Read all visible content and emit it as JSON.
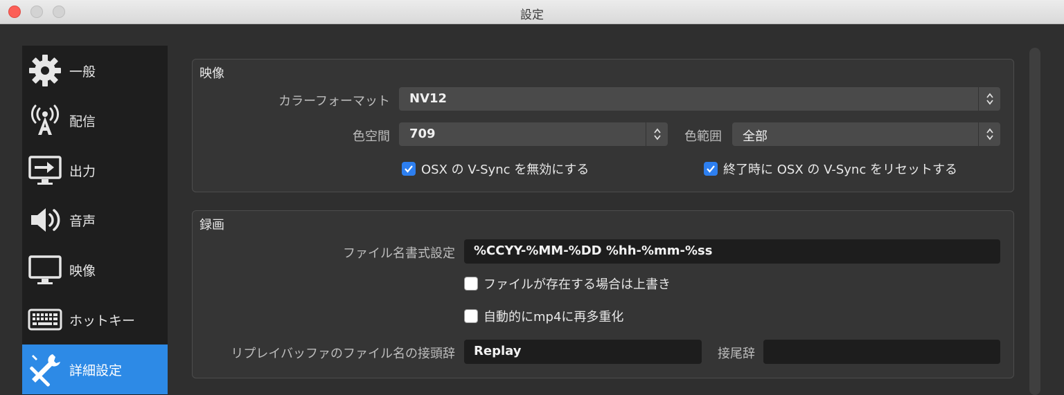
{
  "window": {
    "title": "設定"
  },
  "sidebar": {
    "items": [
      {
        "label": "一般",
        "icon": "gear-icon"
      },
      {
        "label": "配信",
        "icon": "broadcast-antenna-icon"
      },
      {
        "label": "出力",
        "icon": "output-monitor-icon"
      },
      {
        "label": "音声",
        "icon": "speaker-icon"
      },
      {
        "label": "映像",
        "icon": "monitor-icon"
      },
      {
        "label": "ホットキー",
        "icon": "keyboard-icon"
      },
      {
        "label": "詳細設定",
        "icon": "tools-icon",
        "active": true
      }
    ]
  },
  "video_group": {
    "title": "映像",
    "color_format_label": "カラーフォーマット",
    "color_format_value": "NV12",
    "color_space_label": "色空間",
    "color_space_value": "709",
    "color_range_label": "色範囲",
    "color_range_value": "全部",
    "disable_vsync_label": "OSX の V-Sync を無効にする",
    "disable_vsync_checked": true,
    "reset_vsync_label": "終了時に OSX の V-Sync をリセットする",
    "reset_vsync_checked": true
  },
  "recording_group": {
    "title": "録画",
    "filename_format_label": "ファイル名書式設定",
    "filename_format_value": "%CCYY-%MM-%DD %hh-%mm-%ss",
    "overwrite_label": "ファイルが存在する場合は上書き",
    "overwrite_checked": false,
    "automux_label": "自動的にmp4に再多重化",
    "automux_checked": false,
    "replay_prefix_label": "リプレイバッファのファイル名の接頭辞",
    "replay_prefix_value": "Replay",
    "suffix_label": "接尾辞",
    "suffix_value": ""
  },
  "colors": {
    "accent": "#2d8ae6",
    "checkbox": "#2d7ff0",
    "close": "#fc5f57"
  }
}
